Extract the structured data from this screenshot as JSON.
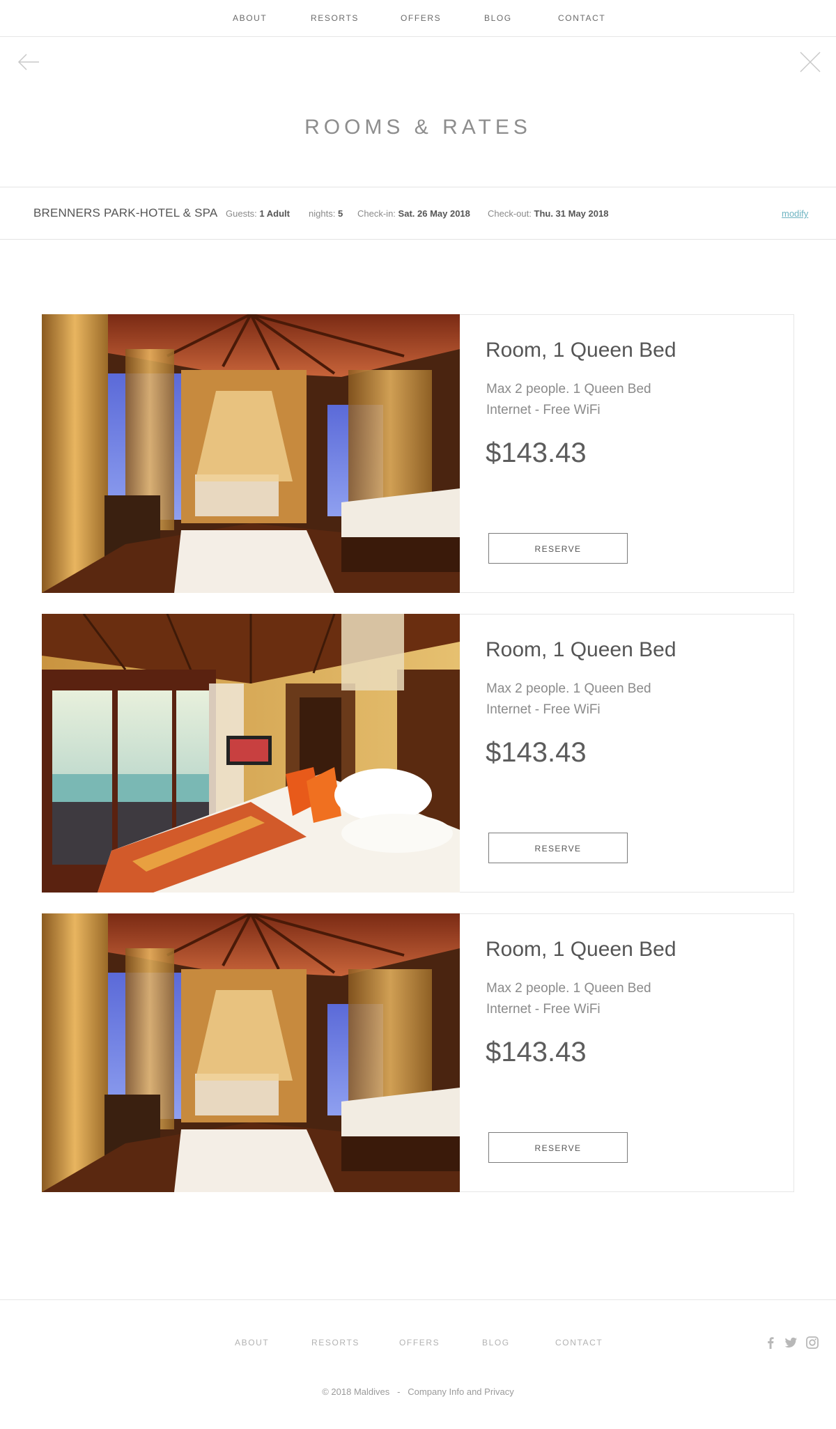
{
  "nav": {
    "items": [
      {
        "label": "ABOUT"
      },
      {
        "label": "RESORTS"
      },
      {
        "label": "OFFERS"
      },
      {
        "label": "BLOG"
      },
      {
        "label": "CONTACT"
      }
    ]
  },
  "page": {
    "title": "ROOMS & RATES",
    "back_icon": "arrow-left-icon",
    "close_icon": "close-icon"
  },
  "summary": {
    "hotel": "BRENNERS PARK-HOTEL & SPA",
    "guests_label": "Guests:",
    "guests_value": "1 Adult",
    "nights_label": "nights:",
    "nights_value": "5",
    "checkin_label": "Check-in:",
    "checkin_value": "Sat. 26 May 2018",
    "checkout_label": "Check-out:",
    "checkout_value": "Thu. 31 May 2018",
    "modify": "modify"
  },
  "rooms": [
    {
      "title": "Room, 1 Queen Bed",
      "line1": "Max 2 people. 1 Queen Bed",
      "line2": "Internet - Free WiFi",
      "price": "$143.43",
      "cta": "RESERVE"
    },
    {
      "title": "Room, 1 Queen Bed",
      "line1": "Max 2 people. 1 Queen Bed",
      "line2": "Internet - Free WiFi",
      "price": "$143.43",
      "cta": "RESERVE"
    },
    {
      "title": "Room, 1 Queen Bed",
      "line1": "Max 2 people. 1 Queen Bed",
      "line2": "Internet - Free WiFi",
      "price": "$143.43",
      "cta": "RESERVE"
    }
  ],
  "footer": {
    "items": [
      {
        "label": "ABOUT"
      },
      {
        "label": "RESORTS"
      },
      {
        "label": "OFFERS"
      },
      {
        "label": "BLOG"
      },
      {
        "label": "CONTACT"
      }
    ],
    "social": [
      "facebook-icon",
      "twitter-icon",
      "instagram-icon"
    ],
    "copyright": "© 2018 Maldives",
    "separator": "-",
    "company_link": "Company Info and Privacy"
  },
  "colors": {
    "accent_link": "#6db3c1",
    "text": "#555555",
    "muted": "#8a8a8a"
  }
}
